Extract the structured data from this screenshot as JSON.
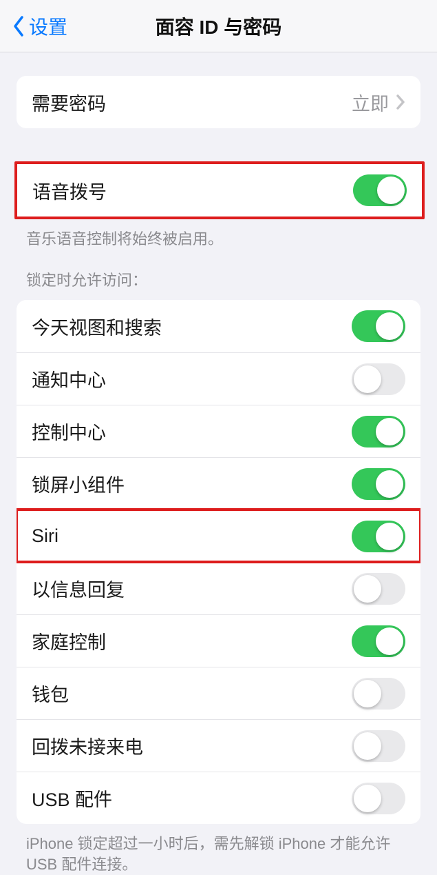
{
  "header": {
    "back_label": "设置",
    "title": "面容 ID 与密码"
  },
  "require_passcode": {
    "label": "需要密码",
    "value": "立即"
  },
  "voice_dial": {
    "label": "语音拨号",
    "on": true,
    "footer": "音乐语音控制将始终被启用。"
  },
  "locked_access": {
    "header": "锁定时允许访问：",
    "items": [
      {
        "label": "今天视图和搜索",
        "on": true
      },
      {
        "label": "通知中心",
        "on": false
      },
      {
        "label": "控制中心",
        "on": true
      },
      {
        "label": "锁屏小组件",
        "on": true
      },
      {
        "label": "Siri",
        "on": true
      },
      {
        "label": "以信息回复",
        "on": false
      },
      {
        "label": "家庭控制",
        "on": true
      },
      {
        "label": "钱包",
        "on": false
      },
      {
        "label": "回拨未接来电",
        "on": false
      },
      {
        "label": "USB 配件",
        "on": false
      }
    ],
    "footer": "iPhone 锁定超过一小时后，需先解锁 iPhone 才能允许 USB 配件连接。"
  }
}
